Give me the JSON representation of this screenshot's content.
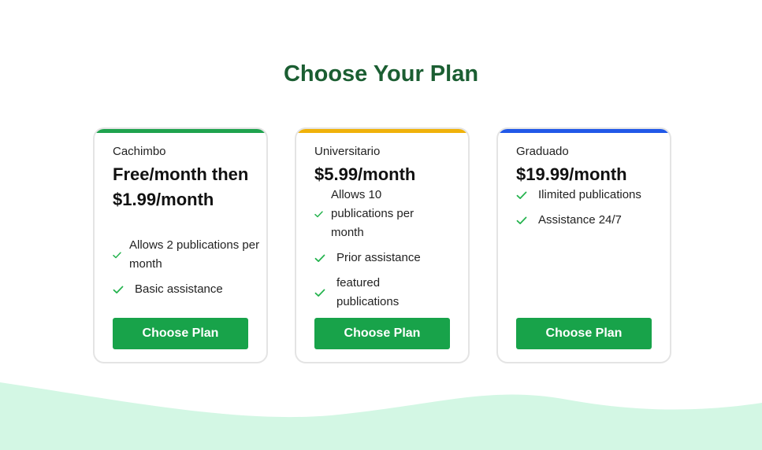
{
  "heading": "Choose Your Plan",
  "colors": {
    "heading": "#1b5e32",
    "button": "#18a34a",
    "check": "#22b24c",
    "wave": "#d3f7e4"
  },
  "plans": [
    {
      "name": "Cachimbo",
      "price": "Free/month then $1.99/month",
      "accent": "#1fa34e",
      "features": [
        "Allows 2 publications per month",
        "Basic assistance"
      ],
      "button": "Choose Plan"
    },
    {
      "name": "Universitario",
      "price": "$5.99/month",
      "accent": "#f0b20a",
      "features": [
        "Allows 10 publications per month",
        "Prior assistance",
        "featured publications"
      ],
      "button": "Choose Plan"
    },
    {
      "name": "Graduado",
      "price": "$19.99/month",
      "accent": "#2158e8",
      "features": [
        "Ilimited publications",
        "Assistance 24/7"
      ],
      "button": "Choose Plan"
    }
  ]
}
